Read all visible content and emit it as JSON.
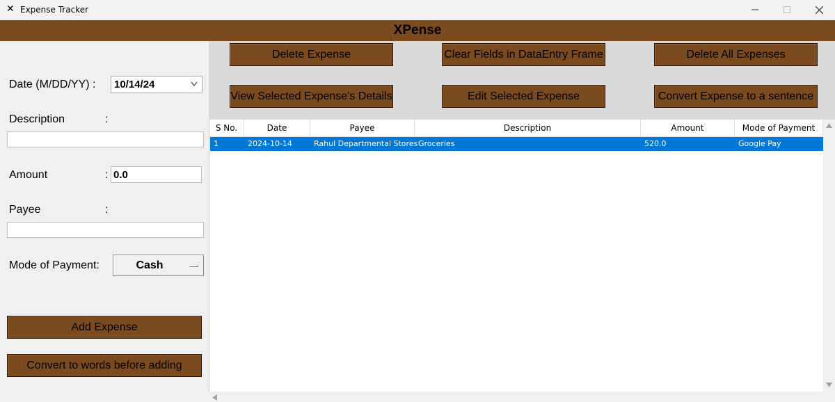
{
  "window": {
    "icon": "x-app-icon",
    "title": "Expense Tracker",
    "controls": [
      "minimize-icon",
      "maximize-icon",
      "close-icon"
    ]
  },
  "header": {
    "title": "XPense"
  },
  "form": {
    "date_label": "Date (M/DD/YY)  :",
    "date_value": "10/14/24",
    "description_label": "Description",
    "description_value": "",
    "amount_label": "Amount",
    "amount_value": "0.0",
    "payee_label": "Payee",
    "payee_value": "",
    "mop_label": "Mode of Payment:",
    "mop_value": "Cash",
    "colon": ":"
  },
  "left_buttons": {
    "add": "Add Expense",
    "convert_words": "Convert to words before adding"
  },
  "actions": {
    "delete": "Delete Expense",
    "clear": "Clear Fields in DataEntry Frame",
    "delete_all": "Delete All Expenses",
    "view": "View Selected Expense's Details",
    "edit": "Edit Selected Expense",
    "convert_sentence": "Convert Expense to a sentence"
  },
  "table": {
    "columns": [
      "S No.",
      "Date",
      "Payee",
      "Description",
      "Amount",
      "Mode of Payment"
    ],
    "rows": [
      [
        "1",
        "2024-10-14",
        "Rahul Departmental Stores",
        "Groceries",
        "520.0",
        "Google Pay"
      ]
    ]
  },
  "colors": {
    "brand_brown": "#7b4a1f",
    "selection_blue": "#0078d7",
    "button_area_bg": "#dadada"
  }
}
